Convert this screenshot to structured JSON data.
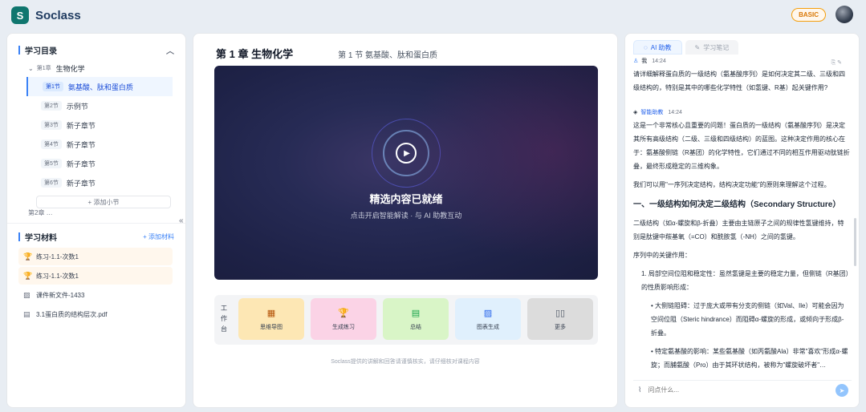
{
  "app": {
    "logo_letter": "S",
    "name": "Soclass",
    "plan_badge": "BASIC"
  },
  "outline": {
    "title": "学习目录",
    "chapter": {
      "tag": "第1章",
      "title": "生物化学"
    },
    "sections": [
      {
        "tag": "第1节",
        "title": "氨基酸、肽和蛋白质",
        "active": true
      },
      {
        "tag": "第2节",
        "title": "示例节",
        "active": false
      },
      {
        "tag": "第3节",
        "title": "新子章节",
        "active": false
      },
      {
        "tag": "第4节",
        "title": "新子章节",
        "active": false
      },
      {
        "tag": "第5节",
        "title": "新子章节",
        "active": false
      },
      {
        "tag": "第6节",
        "title": "新子章节",
        "active": false
      }
    ],
    "add_section": "+ 添加小节",
    "next_chapter": "第2章 …"
  },
  "materials": {
    "title": "学习材料",
    "add_label": "+ 添加材料",
    "items": [
      {
        "icon": "trophy-icon",
        "label": "练习-1.1-次数1",
        "type": "practice"
      },
      {
        "icon": "trophy-icon",
        "label": "练习-1.1-次数1",
        "type": "practice"
      },
      {
        "icon": "image-icon",
        "label": "课件新文件-1433",
        "type": "doc"
      },
      {
        "icon": "doc-icon",
        "label": "3.1蛋白质的结构层次.pdf",
        "type": "doc"
      }
    ]
  },
  "main": {
    "chapter_title": "第 1 章 生物化学",
    "section_title": "第 1 节 氨基酸、肽和蛋白质",
    "video": {
      "title": "精选内容已就绪",
      "subtitle": "点击开启智能解读 · 与 AI 助教互动"
    },
    "workbench_label": "工作台",
    "tools": [
      {
        "icon": "grid-icon",
        "glyph": "▦",
        "label": "思维导图"
      },
      {
        "icon": "trophy-icon",
        "glyph": "🏆",
        "label": "生成练习"
      },
      {
        "icon": "file-icon",
        "glyph": "▤",
        "label": "总结"
      },
      {
        "icon": "image-icon",
        "glyph": "▨",
        "label": "图表生成"
      },
      {
        "icon": "book-icon",
        "glyph": "▯▯",
        "label": "更多"
      }
    ],
    "footnote": "Soclass提供的讲解和回答请谨慎核实，请仔细核对课程内容"
  },
  "assistant": {
    "tabs": [
      {
        "label": "AI 助教",
        "active": true
      },
      {
        "label": "学习笔记",
        "active": false
      }
    ],
    "user_name": "我",
    "user_time": "14:24",
    "user_message": "请详细解释蛋白质的一级结构（氨基酸序列）是如何决定其二级、三级和四级结构的，特别是其中的哪些化学特性（如氢键、R基）起关键作用?",
    "ai_name": "智能助教",
    "ai_time": "14:24",
    "ai_para1": "这是一个非常核心且重要的问题！蛋白质的一级结构（氨基酸序列）是决定其所有高级结构（二级、三级和四级结构）的蓝图。这种决定作用的核心在于：氨基酸侧链（R基团）的化学特性，它们通过不同的相互作用驱动肽链折叠，最终形成稳定的三维构象。",
    "ai_para2": "我们可以用\"一序列决定结构，结构决定功能\"的原则来理解这个过程。",
    "heading1": "一、一级结构如何决定二级结构（Secondary Structure）",
    "ai_para3": "二级结构（如α-螺旋和β-折叠）主要由主链原子之间的规律性氢键维持，特别是肽键中羰基氧（=CO）和酰胺氢（-NH）之间的氢键。",
    "list_title": "序列中的关键作用：",
    "list_item1": "1. 局部空间位阻和稳定性：虽然氢键是主要的稳定力量，但侧链（R基团）的性质影响形成：",
    "sub_item1": "• 大侧链阻碍：过于庞大或带有分支的侧链（如Val、Ile）可能会因为空间位阻（Steric hindrance）而阻碍α-螺旋的形成，或倾向于形成β-折叠。",
    "sub_item2": "• 特定氨基酸的影响：某些氨基酸（如丙氨酸Ala）非常\"喜欢\"形成α-螺旋；而脯氨酸（Pro）由于其环状结构，被称为\"螺旋破坏者\"…",
    "input_placeholder": "问点什么..."
  }
}
